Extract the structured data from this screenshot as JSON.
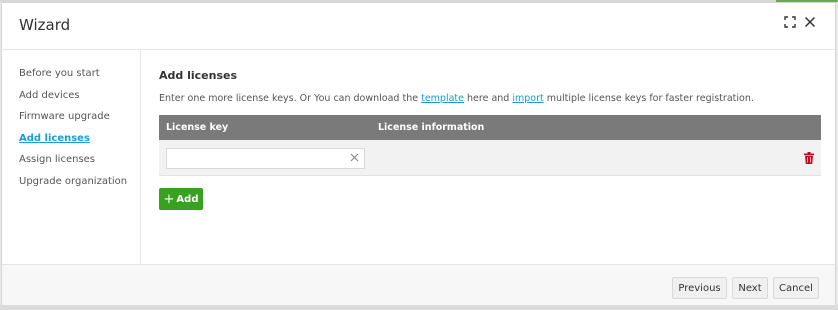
{
  "dialog": {
    "title": "Wizard",
    "icons": {
      "maximize": "expand-icon",
      "close": "close-icon"
    }
  },
  "steps": [
    {
      "label": "Before you start",
      "active": false
    },
    {
      "label": "Add devices",
      "active": false
    },
    {
      "label": "Firmware upgrade",
      "active": false
    },
    {
      "label": "Add licenses",
      "active": true
    },
    {
      "label": "Assign licenses",
      "active": false
    },
    {
      "label": "Upgrade organization",
      "active": false
    }
  ],
  "content": {
    "title": "Add licenses",
    "desc_part1": "Enter one more license keys. Or You can download the ",
    "template_link": "template",
    "desc_part2": " here and ",
    "import_link": "import",
    "desc_part3": " multiple license keys for faster registration.",
    "table": {
      "headers": [
        "License key",
        "License information"
      ],
      "rows": [
        {
          "license_key": "",
          "license_information": ""
        }
      ]
    },
    "add_button": "Add",
    "add_icon": "+"
  },
  "footer": {
    "previous": "Previous",
    "next": "Next",
    "cancel": "Cancel"
  },
  "colors": {
    "accent_link": "#1d9bd7",
    "add_button": "#38a11f",
    "table_header": "#7a7a7a",
    "delete_icon": "#d0021b"
  }
}
